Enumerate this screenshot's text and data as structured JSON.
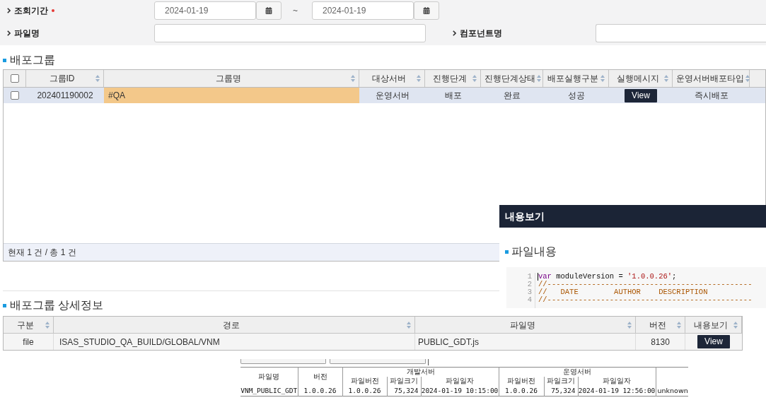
{
  "search": {
    "period": {
      "label": "조회기간",
      "required": true,
      "from": "2024-01-19",
      "separator": "~",
      "to": "2024-01-19"
    },
    "file_name": {
      "label": "파일명"
    },
    "component_name": {
      "label": "컴포넌트명"
    }
  },
  "deploy_groups": {
    "title": "배포그룹",
    "select_all_checked": false,
    "columns": [
      "그룹ID",
      "그룹명",
      "대상서버",
      "진행단계",
      "진행단계상태",
      "배포실행구분",
      "실행메시지",
      "운영서버배포타입"
    ],
    "rows": [
      {
        "selected": true,
        "checked": false,
        "cells": [
          {
            "kind": "text",
            "text": "202401190002"
          },
          {
            "kind": "text",
            "text": "#QA",
            "highlighted": true
          },
          {
            "kind": "text",
            "text": "운영서버"
          },
          {
            "kind": "text",
            "text": "배포"
          },
          {
            "kind": "text",
            "text": "완료"
          },
          {
            "kind": "text",
            "text": "성공"
          },
          {
            "kind": "button",
            "text": "View"
          },
          {
            "kind": "text",
            "text": "즉시배포"
          }
        ]
      }
    ],
    "footer": "현재 1 건 / 총 1 건"
  },
  "content_viewer": {
    "title": "내용보기",
    "section_title": "파일내용",
    "lines": [
      {
        "number": "1",
        "tokens": [
          {
            "kind": "keyword",
            "text": "var"
          },
          {
            "kind": "plain",
            "text": " moduleVersion = "
          },
          {
            "kind": "string",
            "text": "'1.0.0.26'"
          },
          {
            "kind": "plain",
            "text": ";"
          }
        ]
      },
      {
        "number": "2",
        "tokens": [
          {
            "kind": "comment",
            "text": "//----------------------------------------------"
          }
        ]
      },
      {
        "number": "3",
        "tokens": [
          {
            "kind": "comment",
            "text": "//   DATE        AUTHOR    DESCRIPTION"
          }
        ]
      },
      {
        "number": "4",
        "tokens": [
          {
            "kind": "comment",
            "text": "//----------------------------------------------"
          }
        ]
      }
    ]
  },
  "detail": {
    "title": "배포그룹 상세정보",
    "columns": [
      "구분",
      "경로",
      "파일명",
      "버전",
      "내용보기"
    ],
    "rows": [
      {
        "cells": [
          {
            "kind": "text",
            "text": "file"
          },
          {
            "kind": "text",
            "text": "ISAS_STUDIO_QA_BUILD/GLOBAL/VNM"
          },
          {
            "kind": "text",
            "text": "PUBLIC_GDT.js"
          },
          {
            "kind": "text",
            "text": "8130"
          },
          {
            "kind": "button",
            "text": "View"
          }
        ]
      }
    ]
  },
  "file_compare": {
    "file_name_header": "파일명",
    "version_header": "버전",
    "groups": [
      {
        "label": "개발서버",
        "columns": [
          "파일버전",
          "파일크기",
          "파일일자"
        ]
      },
      {
        "label": "운영서버",
        "columns": [
          "파일버전",
          "파일크기",
          "파일일자"
        ]
      }
    ],
    "rows": [
      {
        "cells": [
          "VNM_PUBLIC_GDT",
          "1.0.0.26",
          "1.0.0.26",
          "75,324",
          "2024-01-19 10:15:00",
          "1.0.0.26",
          "75,324",
          "2024-01-19 12:56:00",
          "unknown"
        ]
      }
    ]
  }
}
